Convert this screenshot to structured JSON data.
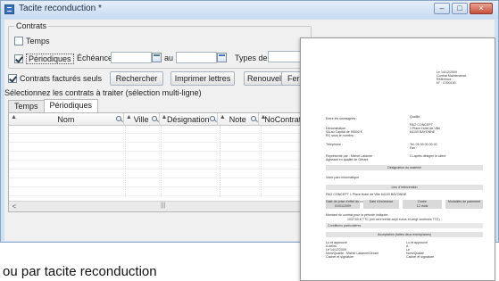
{
  "window": {
    "title": "Tacite reconduction *",
    "controls": [
      "–",
      "□",
      "×"
    ]
  },
  "filters": {
    "group_label": "Contrats",
    "temps_label": "Temps",
    "periodiques_label": "Périodiques",
    "echeance_label": "Échéance du",
    "au_label": "au",
    "types_label": "Types de Contrats",
    "echeance_from": "",
    "echeance_to": "",
    "types_value": ""
  },
  "options": {
    "factures_label": "Contrats facturés seuls"
  },
  "actions": {
    "rechercher": "Rechercher",
    "imprimer": "Imprimer lettres",
    "renouveler": "Renouveler",
    "fermer": "Ferm"
  },
  "instructions": "Sélectionnez les contrats à traiter (sélection multi-ligne)",
  "tabs": [
    {
      "label": "Temps"
    },
    {
      "label": "Périodiques"
    }
  ],
  "grid": {
    "columns": [
      "Nom",
      "Ville",
      "Désignation",
      "Note",
      "NoContrat"
    ],
    "scroll_left": "<",
    "grip": "|||"
  },
  "document": {
    "date_line": "Le 14/12/2009",
    "service_line": "Contrat Maintenance",
    "ref_line": "Référence :",
    "no_line": "N° : C000150",
    "entre_label": "Entre les soussignés :",
    "qualite_label": "Qualité :",
    "societe_label": "Dénomination",
    "societe_val": "PAO CONCEPT",
    "capital_label": "SA au Capital de 99000 €",
    "rue_val": "1 Place Hotel de Ville",
    "rcs_label": "RC sous le numéro :",
    "cp_val": "64100 BAYONNE",
    "tel_label": "Téléphone :",
    "tel_val": "Tel: 05 59 00 00 00",
    "fax_val": "Fax :",
    "rep_label": "Représenté par : Michel Lalanne",
    "rep2_label": "Agissant en qualité de Gérant",
    "ci_label": "Ci-après désigné le client",
    "designation_title": "Désignation du matériel",
    "materiel_line": "Votre parc informatique",
    "lieu_title": "Lieu d'intervention",
    "lieu_line": "PAO CONCEPT 1 Place Hotel de Ville 64100 BAYONNE",
    "col_date": "Date de prise d'effet du contrat",
    "col_date_val": "01/01/2009",
    "col_echeance": "Date d'échéance",
    "col_duree": "Durée",
    "col_duree_val": "12 mois",
    "col_modalite": "Modalités de paiement",
    "montant_line": "Montant du contrat pour la période indiquée :",
    "montant_val": "1037,00 € TTC (mil cent trente-sept euros et vingt centimes TTC)",
    "conditions_title": "Conditions particulières",
    "accept_title": "Acceptation (faites deux exemplaires)",
    "sig_left_1": "Lu et approuvé",
    "sig_left_2": "A délim",
    "sig_left_3": "Le 14/12/2009",
    "sig_left_4": "Nom/Qualité : Michel Lalanne/Gérant",
    "sig_left_5": "Cachet et signature",
    "sig_right_1": "Lu et approuvé",
    "sig_right_2": "A",
    "sig_right_3": "Le",
    "sig_right_4": "Nom/Qualité",
    "sig_right_5": "Cachet et signature"
  },
  "page_text": "ou par tacite reconduction"
}
